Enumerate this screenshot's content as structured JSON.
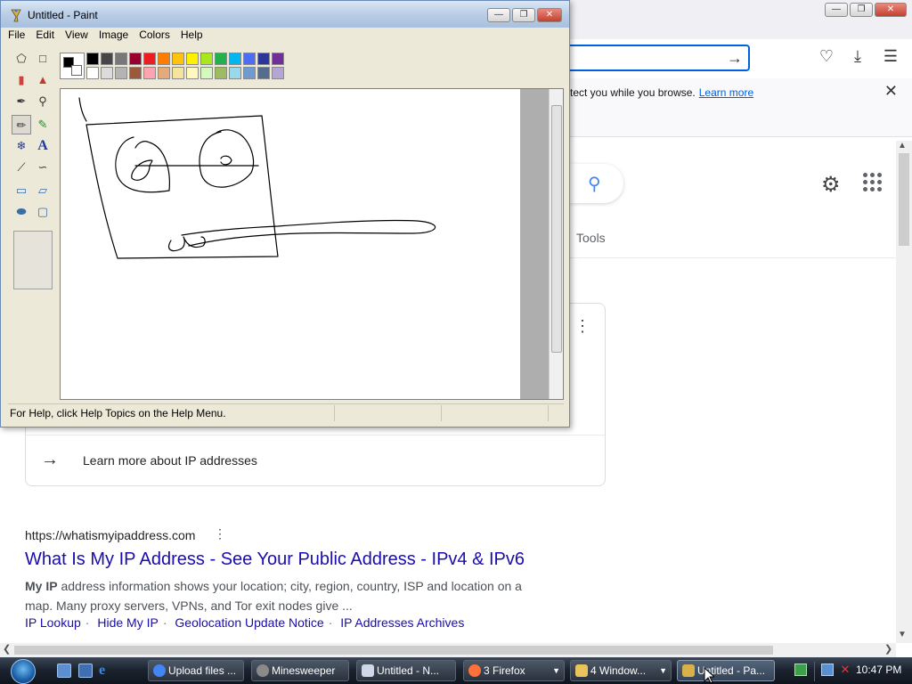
{
  "browser": {
    "notification": {
      "text": "tect you while you browse.",
      "link": "Learn more",
      "close_icon": "close-icon"
    },
    "toolbar_icons": [
      "pocket-icon",
      "downloads-icon",
      "menu-icon"
    ],
    "google": {
      "tools_label": "Tools",
      "learn_more_card": "Learn more about IP addresses"
    },
    "result": {
      "url": "https://whatismyipaddress.com",
      "title": "What Is My IP Address - See Your Public Address - IPv4 & IPv6",
      "snippet_bold": "My IP",
      "snippet": " address information shows your location; city, region, country, ISP and location on a map. Many proxy servers, VPNs, and Tor exit nodes give ...",
      "sitelinks": [
        "IP Lookup",
        "Hide My IP",
        "Geolocation Update Notice",
        "IP Addresses Archives"
      ]
    }
  },
  "paint": {
    "title": "Untitled - Paint",
    "menu": [
      "File",
      "Edit",
      "View",
      "Image",
      "Colors",
      "Help"
    ],
    "status": "For Help, click Help Topics on the Help Menu.",
    "tools": [
      "free-form-select-icon",
      "select-icon",
      "eraser-icon",
      "fill-icon",
      "color-picker-icon",
      "magnifier-icon",
      "pencil-icon",
      "brush-icon",
      "airbrush-icon",
      "text-icon",
      "line-icon",
      "curve-icon",
      "rectangle-icon",
      "polygon-icon",
      "ellipse-icon",
      "rounded-rectangle-icon"
    ],
    "text_tool_glyph": "A",
    "foreground_color": "#000000",
    "background_color": "#ffffff",
    "palette_row1": [
      "#000000",
      "#464646",
      "#787878",
      "#990030",
      "#ed1c24",
      "#ff7e00",
      "#ffc20e",
      "#fff200",
      "#a8e61d",
      "#22b14c",
      "#00b7ef",
      "#4d6df3",
      "#2f3699",
      "#6f3198"
    ],
    "palette_row2": [
      "#ffffff",
      "#dcdcdc",
      "#b4b4b4",
      "#9c5a3c",
      "#ffa3b1",
      "#e5aa7a",
      "#f5e49c",
      "#fff9bd",
      "#d3f9bc",
      "#9dbb61",
      "#99d9ea",
      "#709ad1",
      "#546d8e",
      "#b5a5d5"
    ]
  },
  "taskbar": {
    "tasks": [
      {
        "label": "Upload files ...",
        "icon_color": "#4285f4"
      },
      {
        "label": "Minesweeper",
        "icon_color": "#8a8a8a"
      },
      {
        "label": "Untitled - N...",
        "icon_color": "#cfd8e6"
      },
      {
        "label": "3 Firefox",
        "icon_color": "#ff7139"
      },
      {
        "label": "4 Window...",
        "icon_color": "#e8c45a"
      },
      {
        "label": "Untitled - Pa...",
        "icon_color": "#d9b04a"
      }
    ],
    "clock": "10:47 PM"
  }
}
